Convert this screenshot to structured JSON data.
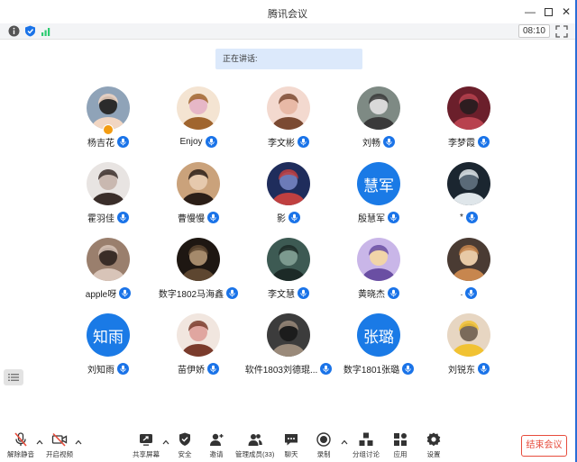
{
  "window": {
    "title": "腾讯会议"
  },
  "status": {
    "timer": "08:10"
  },
  "speaking": {
    "label": "正在讲话:"
  },
  "participants": [
    {
      "name": "杨吉花",
      "avatar": "photo"
    },
    {
      "name": "Enjoy",
      "avatar": "photo"
    },
    {
      "name": "李文彬",
      "avatar": "photo"
    },
    {
      "name": "刘畅",
      "avatar": "photo"
    },
    {
      "name": "李梦霞",
      "avatar": "photo"
    },
    {
      "name": "霍羽佳",
      "avatar": "photo"
    },
    {
      "name": "曹慢慢",
      "avatar": "photo"
    },
    {
      "name": "影",
      "avatar": "photo"
    },
    {
      "name": "殷慧军",
      "avatar": "text",
      "avatar_text": "慧军"
    },
    {
      "name": "*",
      "avatar": "photo"
    },
    {
      "name": "apple呀",
      "avatar": "photo"
    },
    {
      "name": "数字1802马海鑫",
      "avatar": "photo"
    },
    {
      "name": "李文慧",
      "avatar": "photo"
    },
    {
      "name": "黄晓杰",
      "avatar": "photo"
    },
    {
      "name": ".",
      "avatar": "photo"
    },
    {
      "name": "刘知雨",
      "avatar": "text",
      "avatar_text": "知雨"
    },
    {
      "name": "苗伊娇",
      "avatar": "photo"
    },
    {
      "name": "软件1803刘德琨...",
      "avatar": "photo"
    },
    {
      "name": "数字1801张璐",
      "avatar": "text",
      "avatar_text": "张璐"
    },
    {
      "name": "刘锐东",
      "avatar": "photo"
    }
  ],
  "toolbar": {
    "unmute": "解除静音",
    "start_video": "开启视频",
    "share_screen": "共享屏幕",
    "security": "安全",
    "invite": "邀请",
    "manage_members": "管理成员(33)",
    "chat": "聊天",
    "record": "录制",
    "breakout": "分组讨论",
    "apps": "应用",
    "settings": "设置",
    "end_meeting": "结束会议"
  },
  "colors": {
    "accent": "#1a73e8",
    "danger": "#e74c3c",
    "border": "#2a6dd6"
  }
}
